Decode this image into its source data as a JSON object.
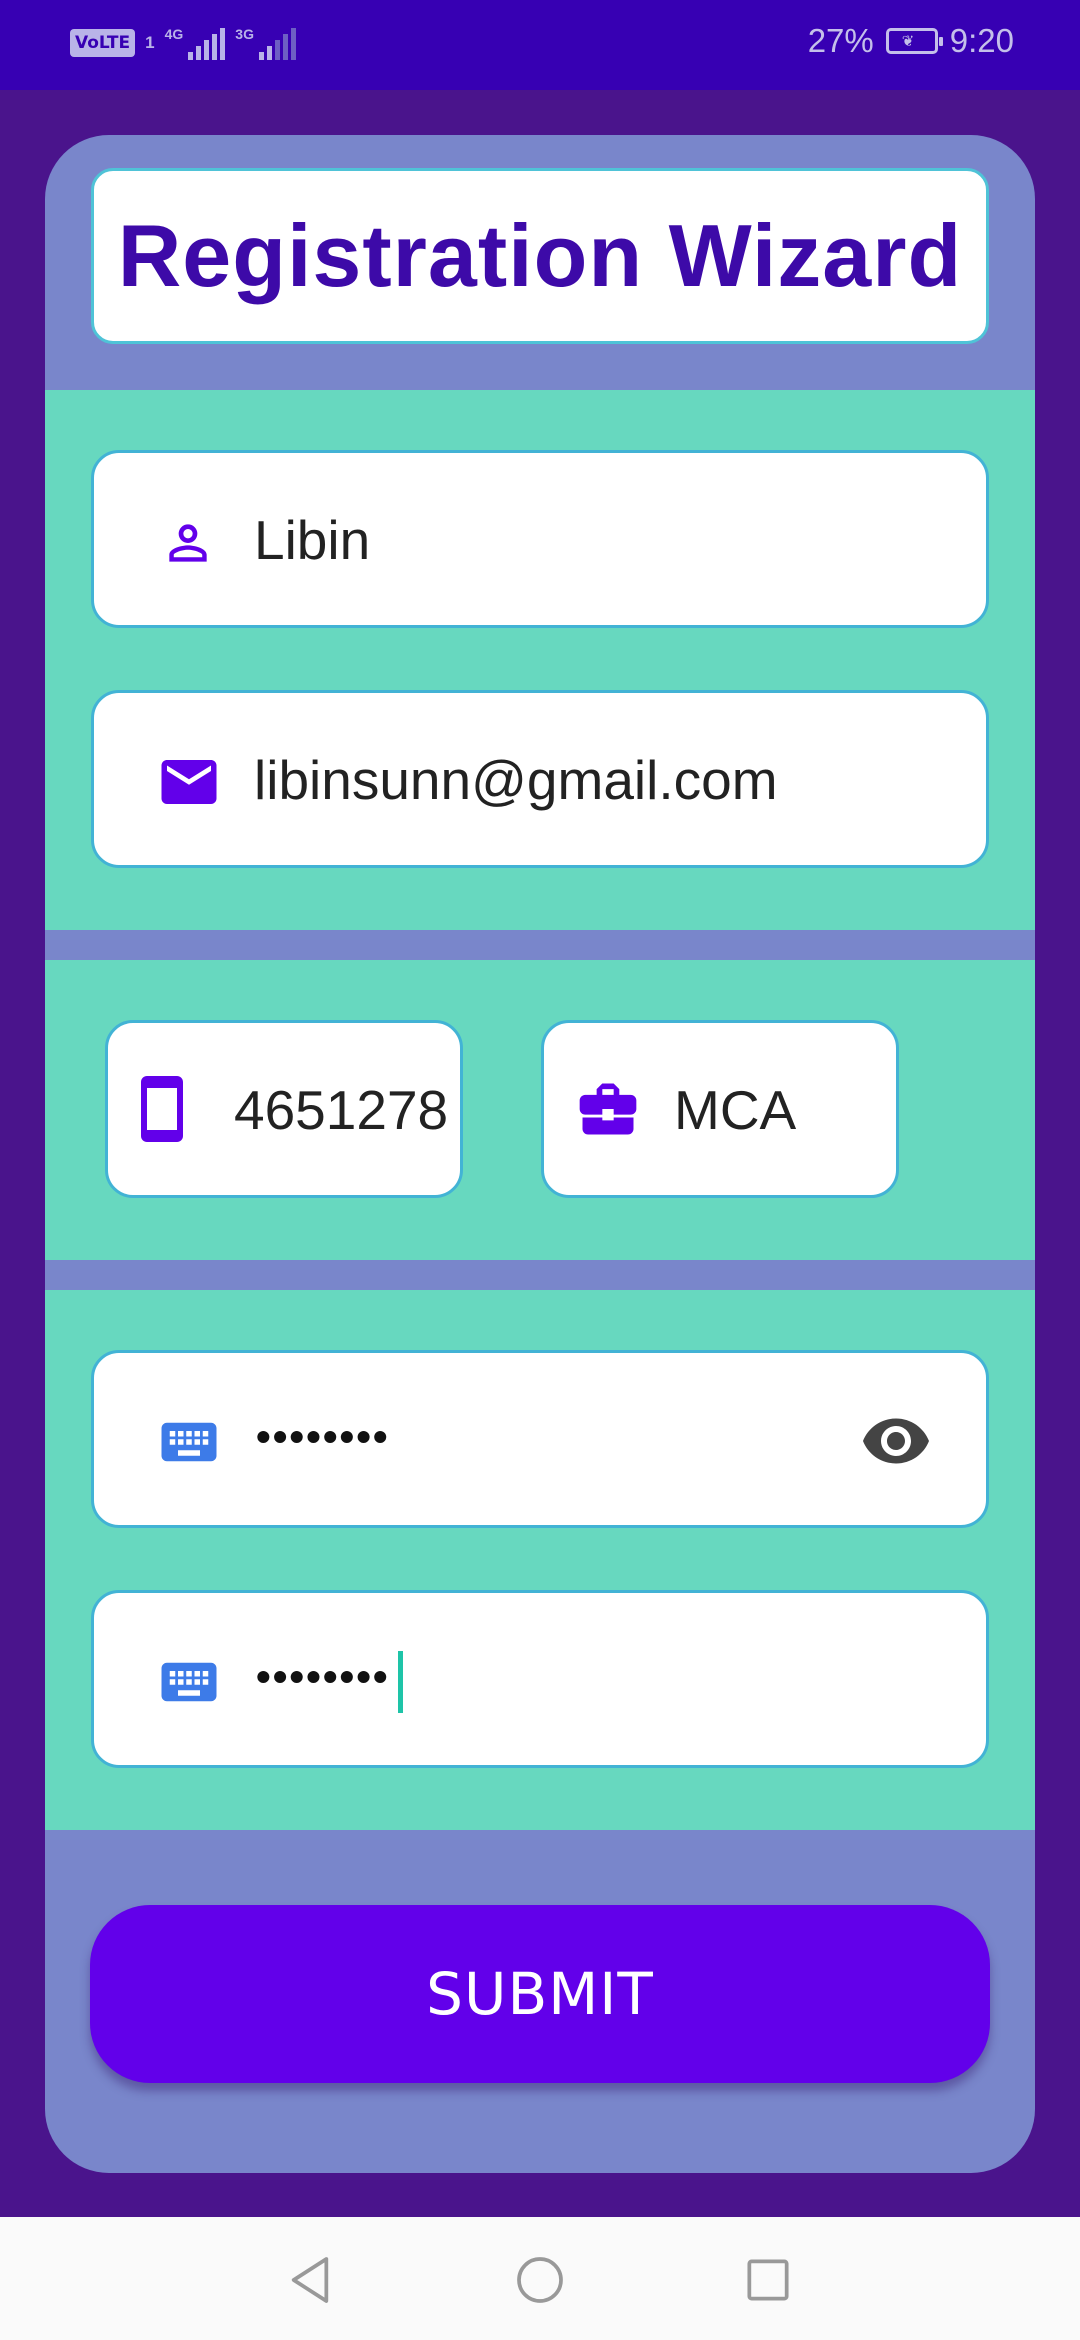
{
  "status_bar": {
    "volte": "VoLTE",
    "sim": "1",
    "net1": "4G",
    "net2": "3G",
    "battery_pct": "27%",
    "time": "9:20"
  },
  "title": "Registration Wizard",
  "fields": {
    "name": {
      "icon": "person-icon",
      "value": "Libin"
    },
    "email": {
      "icon": "email-icon",
      "value": "libinsunn@gmail.com"
    },
    "phone": {
      "icon": "smartphone-icon",
      "value": "4651278"
    },
    "qualification": {
      "icon": "briefcase-icon",
      "value": "MCA"
    },
    "password": {
      "icon": "keyboard-icon",
      "value": "••••••••",
      "toggle_icon": "eye-icon"
    },
    "confirm_password": {
      "icon": "keyboard-icon",
      "value": "••••••••"
    }
  },
  "submit_label": "SUBMIT",
  "colors": {
    "background": "#4a148c",
    "status_bar": "#3700b3",
    "card": "#7986cb",
    "section": "#67d8bf",
    "accent": "#6200ea",
    "title_text": "#3d0aa8"
  },
  "nav": [
    "back-icon",
    "home-icon",
    "recents-icon"
  ]
}
